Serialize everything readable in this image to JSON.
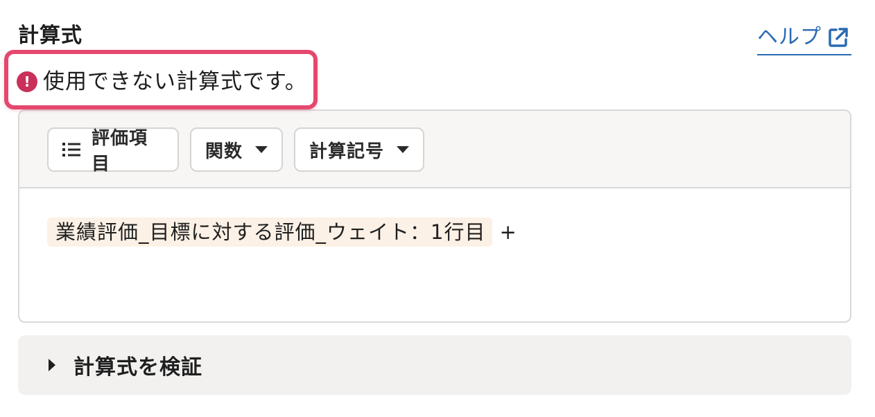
{
  "section": {
    "title": "計算式"
  },
  "help": {
    "label": "ヘルプ",
    "icon": "external-link-icon"
  },
  "error": {
    "icon": "error-circle-icon",
    "message": "使用できない計算式です。"
  },
  "toolbar": {
    "items": [
      {
        "label": "評価項目",
        "icon": "list-icon"
      },
      {
        "label": "関数",
        "icon": "caret-down-icon"
      },
      {
        "label": "計算記号",
        "icon": "caret-down-icon"
      }
    ]
  },
  "formula": {
    "token": "業績評価_目標に対する評価_ウェイト：1行目",
    "operator": "+"
  },
  "verify": {
    "label": "計算式を検証",
    "icon": "caret-right-icon"
  },
  "colors": {
    "accent_link": "#2a6ab3",
    "error": "#c9305a",
    "highlight_border": "#e5486f",
    "token_bg": "#fcf1e6",
    "toolbar_bg": "#f7f6f4"
  }
}
